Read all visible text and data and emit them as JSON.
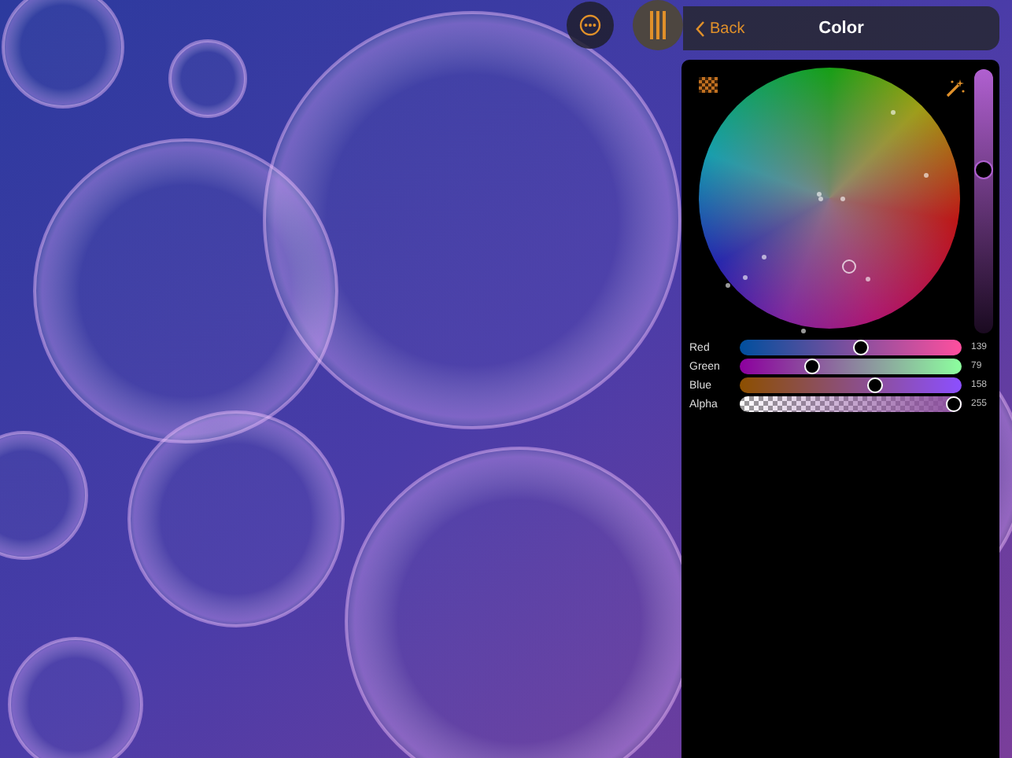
{
  "header": {
    "back": "Back",
    "title": "Color"
  },
  "brightness": {
    "level": 0.62
  },
  "sliders": [
    {
      "label": "Red",
      "value": "139",
      "level": 0.55,
      "kind": "red"
    },
    {
      "label": "Green",
      "value": "79",
      "level": 0.31,
      "kind": "green"
    },
    {
      "label": "Blue",
      "value": "158",
      "level": 0.62,
      "kind": "blue"
    },
    {
      "label": "Alpha",
      "value": "255",
      "level": 1,
      "kind": "alpha"
    }
  ]
}
